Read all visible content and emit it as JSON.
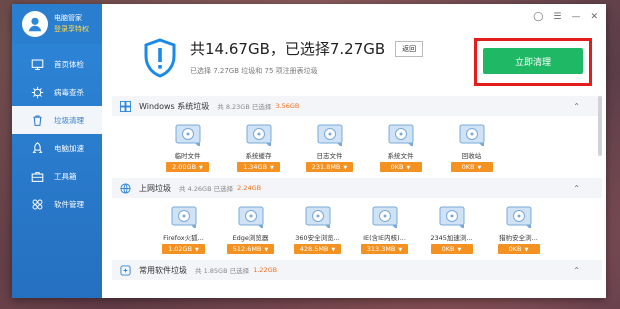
{
  "profile": {
    "name": "电脑管家",
    "login": "登录享特权"
  },
  "nav": [
    {
      "label": "首页体检",
      "icon": "monitor-icon"
    },
    {
      "label": "病毒查杀",
      "icon": "virus-icon"
    },
    {
      "label": "垃圾清理",
      "icon": "trash-icon"
    },
    {
      "label": "电脑加速",
      "icon": "rocket-icon"
    },
    {
      "label": "工具箱",
      "icon": "toolbox-icon"
    },
    {
      "label": "软件管理",
      "icon": "apps-icon"
    }
  ],
  "active_nav": 2,
  "header": {
    "title": "共14.67GB，已选择7.27GB",
    "back_label": "返回",
    "subtitle": "已选择 7.27GB 垃圾和 75 项注册表垃圾"
  },
  "clean_button": "立即清理",
  "sections": [
    {
      "title": "Windows 系统垃圾",
      "total": "共 8.23GB 已选择",
      "selected": "3.56GB",
      "items": [
        {
          "label": "临时文件",
          "size": "2.00GB"
        },
        {
          "label": "系统缓存",
          "size": "1.34GB"
        },
        {
          "label": "日志文件",
          "size": "231.8MB"
        },
        {
          "label": "系统文件",
          "size": "0KB"
        },
        {
          "label": "回收站",
          "size": "0KB"
        }
      ]
    },
    {
      "title": "上网垃圾",
      "total": "共 4.26GB 已选择",
      "selected": "2.24GB",
      "items": [
        {
          "label": "Firefox火狐...",
          "size": "1.02GB"
        },
        {
          "label": "Edge浏览器",
          "size": "512.6MB"
        },
        {
          "label": "360安全浏览...",
          "size": "428.5MB"
        },
        {
          "label": "IE(含IE内核)...",
          "size": "313.3MB"
        },
        {
          "label": "2345加速浏...",
          "size": "0KB"
        },
        {
          "label": "猎豹安全浏...",
          "size": "0KB"
        }
      ]
    },
    {
      "title": "常用软件垃圾",
      "total": "共 1.85GB 已选择",
      "selected": "1.22GB",
      "items": []
    }
  ],
  "colors": {
    "accent": "#2d86d8",
    "clean": "#1fb865",
    "tag": "#f39121",
    "highlight": "#e51c1c"
  }
}
